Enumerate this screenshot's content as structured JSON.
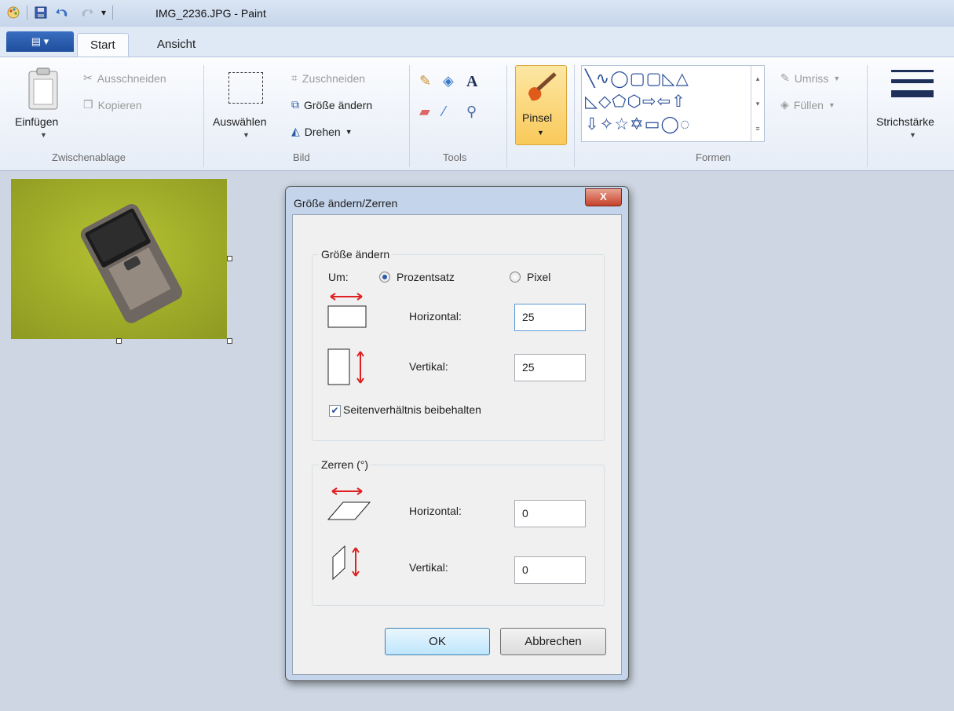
{
  "window": {
    "title": "IMG_2236.JPG - Paint"
  },
  "tabs": {
    "app_menu": "▤ ▾",
    "start": "Start",
    "ansicht": "Ansicht"
  },
  "ribbon": {
    "clipboard": {
      "paste": "Einfügen",
      "cut": "Ausschneiden",
      "copy": "Kopieren",
      "group": "Zwischenablage"
    },
    "image": {
      "select": "Auswählen",
      "crop": "Zuschneiden",
      "resize": "Größe ändern",
      "rotate": "Drehen",
      "group": "Bild"
    },
    "tools": {
      "group": "Tools"
    },
    "brush": {
      "label": "Pinsel"
    },
    "shapes": {
      "outline": "Umriss",
      "fill": "Füllen",
      "group": "Formen"
    },
    "stroke": {
      "label": "Strichstärke"
    }
  },
  "dialog": {
    "title": "Größe ändern/Zerren",
    "close": "X",
    "resize": {
      "legend": "Größe ändern",
      "by_label": "Um:",
      "percent_label": "Prozentsatz",
      "pixel_label": "Pixel",
      "horizontal_label": "Horizontal:",
      "horizontal_value": "25",
      "vertical_label": "Vertikal:",
      "vertical_value": "25",
      "keep_ratio_label": "Seitenverhältnis beibehalten",
      "keep_ratio_checked": true,
      "selected_unit": "Prozentsatz"
    },
    "skew": {
      "legend": "Zerren (°)",
      "horizontal_label": "Horizontal:",
      "horizontal_value": "0",
      "vertical_label": "Vertikal:",
      "vertical_value": "0"
    },
    "ok": "OK",
    "cancel": "Abbrechen"
  },
  "colors": {
    "canvas_bg": "#cdd6e2",
    "image_bg": "#a4b42c",
    "accent_red": "#e02020",
    "selected_tool": "#fbd46a"
  }
}
